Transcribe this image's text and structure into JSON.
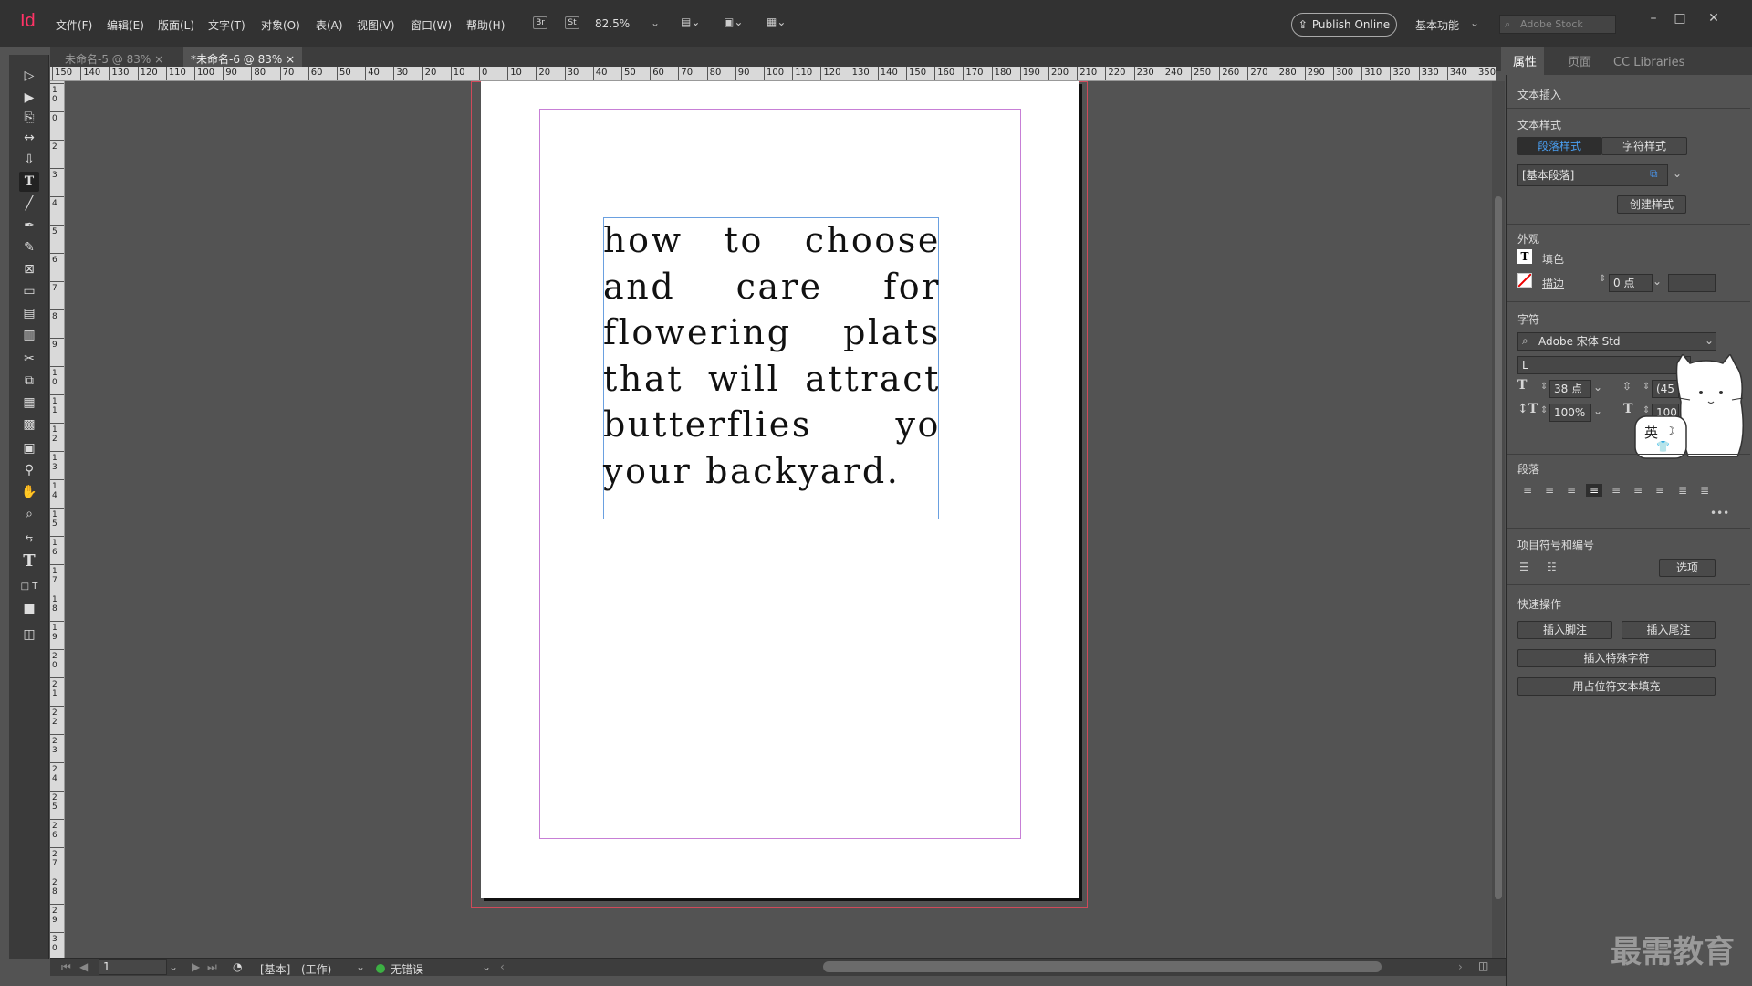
{
  "app": {
    "logo": "Id"
  },
  "menu": [
    "文件(F)",
    "编辑(E)",
    "版面(L)",
    "文字(T)",
    "对象(O)",
    "表(A)",
    "视图(V)",
    "窗口(W)",
    "帮助(H)"
  ],
  "toolbar_top": {
    "bridge": "Br",
    "stock": "St",
    "zoom": "82.5%",
    "publish": "Publish Online",
    "workspace": "基本功能",
    "search_placeholder": "Adobe Stock"
  },
  "tabs": [
    {
      "label": "未命名-5 @ 83%"
    },
    {
      "label": "*未命名-6 @ 83%"
    }
  ],
  "hruler": [
    "150",
    "140",
    "130",
    "120",
    "110",
    "100",
    "90",
    "80",
    "70",
    "60",
    "50",
    "40",
    "30",
    "20",
    "10",
    "0",
    "10",
    "20",
    "30",
    "40",
    "50",
    "60",
    "70",
    "80",
    "90",
    "100",
    "110",
    "120",
    "130",
    "140",
    "150",
    "160",
    "170",
    "180",
    "190",
    "200",
    "210",
    "220",
    "230",
    "240",
    "250",
    "260",
    "270",
    "280",
    "290",
    "300",
    "310",
    "320",
    "330",
    "340",
    "350"
  ],
  "vruler": [
    "10",
    "0",
    "2",
    "3",
    "4",
    "5",
    "6",
    "7",
    "8",
    "9",
    "10",
    "11",
    "12",
    "13",
    "14",
    "15",
    "16",
    "17",
    "18",
    "19",
    "20",
    "21",
    "22",
    "23",
    "24",
    "25",
    "26",
    "27",
    "28",
    "29",
    "30"
  ],
  "document": {
    "text": "how to choose and care for flowering plats that will attract butterflies yo your backyard."
  },
  "status": {
    "page": "1",
    "master": "[基本]",
    "mode": "(工作)",
    "preflight": "无错误"
  },
  "panel": {
    "tabs": [
      "属性",
      "页面",
      "CC Libraries"
    ],
    "text_insert": "文本插入",
    "text_style": "文本样式",
    "para_style_tab": "段落样式",
    "char_style_tab": "字符样式",
    "para_style_value": "[基本段落]",
    "create_style": "创建样式",
    "appearance": "外观",
    "fill": "填色",
    "stroke": "描边",
    "stroke_value": "0 点",
    "character": "字符",
    "font": "Adobe 宋体 Std",
    "font_style": "L",
    "font_size": "38 点",
    "leading": "(45",
    "vscale": "100%",
    "hscale": "100",
    "paragraph": "段落",
    "bullets": "项目符号和编号",
    "options": "选项",
    "quick_actions": "快速操作",
    "insert_footnote": "插入脚注",
    "insert_endnote": "插入尾注",
    "insert_special": "插入特殊字符",
    "fill_placeholder": "用占位符文本填充",
    "ime": "英"
  },
  "watermark": "最需教育",
  "colors": {
    "accent": "#4a90e2",
    "logo": "#ff3366"
  }
}
